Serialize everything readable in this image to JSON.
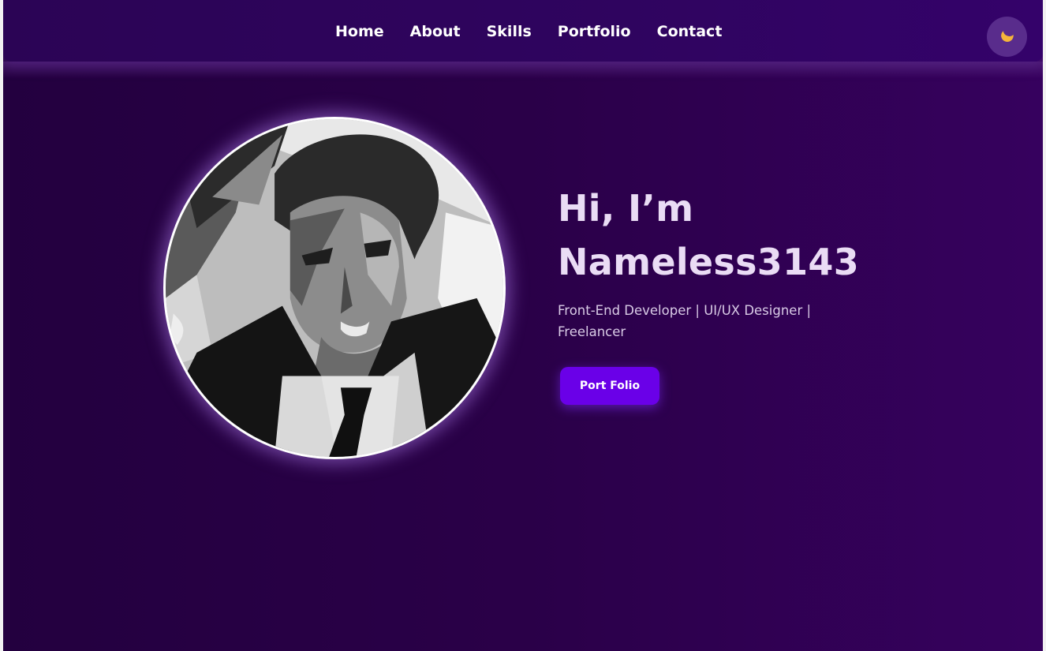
{
  "nav": {
    "links": [
      {
        "label": "Home"
      },
      {
        "label": "About"
      },
      {
        "label": "Skills"
      },
      {
        "label": "Portfolio"
      },
      {
        "label": "Contact"
      }
    ],
    "theme_toggle_icon": "moon-icon"
  },
  "hero": {
    "greeting": "Hi, I’m",
    "name": "Nameless3143",
    "subtitle": "Front-End Developer | UI/UX Designer | Freelancer",
    "cta_label": "Port Folio",
    "avatar_icon": "avatar-illustration"
  },
  "colors": {
    "background_start": "#23003f",
    "background_end": "#36015e",
    "navbar": "#2f045f",
    "accent_button": "#6a00e8",
    "moon": "#f5b53a",
    "heading_text": "#eadcf5"
  }
}
